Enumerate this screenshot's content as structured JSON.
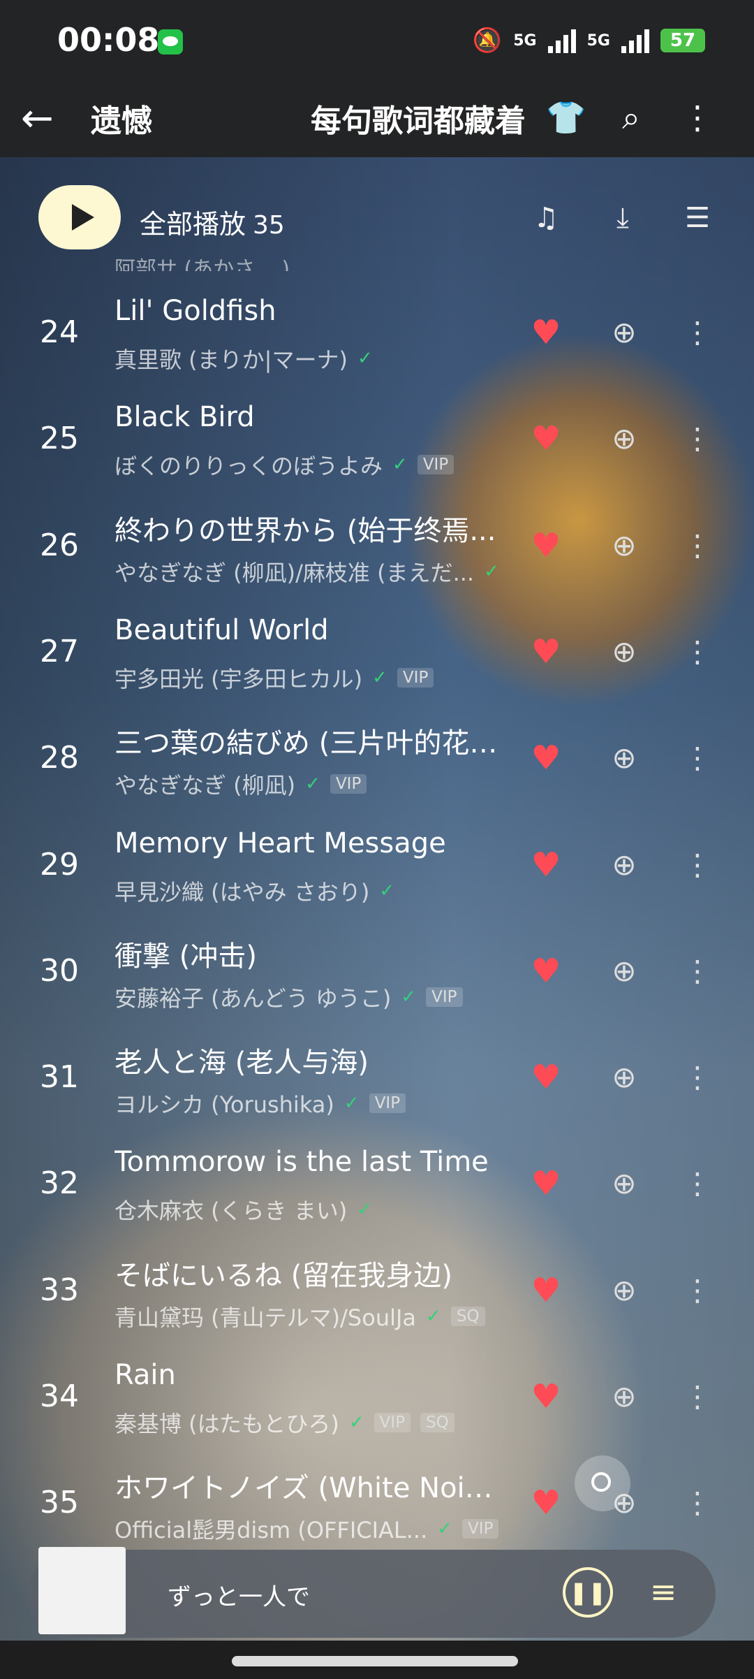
{
  "status": {
    "time": "00:08",
    "network1": "5G",
    "network2": "5G",
    "battery": "57"
  },
  "topbar": {
    "title_left": "遗憾",
    "title_right": "每句歌词都藏着",
    "back_glyph": "←",
    "shirt_glyph": "👕",
    "search_glyph": "⌕",
    "more_glyph": "⋮"
  },
  "playall": {
    "label": "全部播放",
    "count": "35",
    "icons": {
      "music_add": "♫",
      "download": "⤓",
      "multi_select": "☰"
    }
  },
  "partial_row_text": "阿部サ (あかさ ...)",
  "songs": [
    {
      "num": "24",
      "title": "Lil' Goldfish",
      "artist": "真里歌 (まりか|マーナ)",
      "tags": []
    },
    {
      "num": "25",
      "title": "Black Bird",
      "artist": "ぼくのりりっくのぼうよみ",
      "tags": [
        "VIP"
      ]
    },
    {
      "num": "26",
      "title": "終わりの世界から (始于终焉...",
      "artist": "やなぎなぎ (柳凪)/麻枝准 (まえだ...",
      "tags": []
    },
    {
      "num": "27",
      "title": "Beautiful World",
      "artist": "宇多田光 (宇多田ヒカル)",
      "tags": [
        "VIP"
      ]
    },
    {
      "num": "28",
      "title": "三つ葉の結びめ (三片叶的花结)",
      "artist": "やなぎなぎ (柳凪)",
      "tags": [
        "VIP"
      ]
    },
    {
      "num": "29",
      "title": "Memory Heart Message",
      "artist": "早見沙織 (はやみ さおり)",
      "tags": []
    },
    {
      "num": "30",
      "title": "衝撃 (冲击)",
      "artist": "安藤裕子 (あんどう ゆうこ)",
      "tags": [
        "VIP"
      ]
    },
    {
      "num": "31",
      "title": "老人と海 (老人与海)",
      "artist": "ヨルシカ (Yorushika)",
      "tags": [
        "VIP"
      ]
    },
    {
      "num": "32",
      "title": "Tommorow is the last Time",
      "artist": "仓木麻衣 (くらき まい)",
      "tags": []
    },
    {
      "num": "33",
      "title": "そばにいるね (留在我身边)",
      "artist": "青山黛玛 (青山テルマ)/SoulJa",
      "tags": [
        "SQ"
      ]
    },
    {
      "num": "34",
      "title": "Rain",
      "artist": "秦基博 (はたもとひろ)",
      "tags": [
        "VIP",
        "SQ"
      ]
    },
    {
      "num": "35",
      "title": "ホワイトノイズ (White Noise)",
      "artist": "Official髭男dism (OFFICIAL...",
      "tags": [
        "VIP"
      ]
    }
  ],
  "row_glyphs": {
    "heart": "♥",
    "add": "⊕",
    "more": "⋮",
    "check": "✓"
  },
  "player": {
    "now_playing": "ずっと一人で",
    "pause_glyph": "❚❚",
    "queue_glyph": "≡"
  },
  "colors": {
    "heart": "#ff4b55",
    "check": "#33d17a",
    "play_button": "#fdf7d2"
  }
}
